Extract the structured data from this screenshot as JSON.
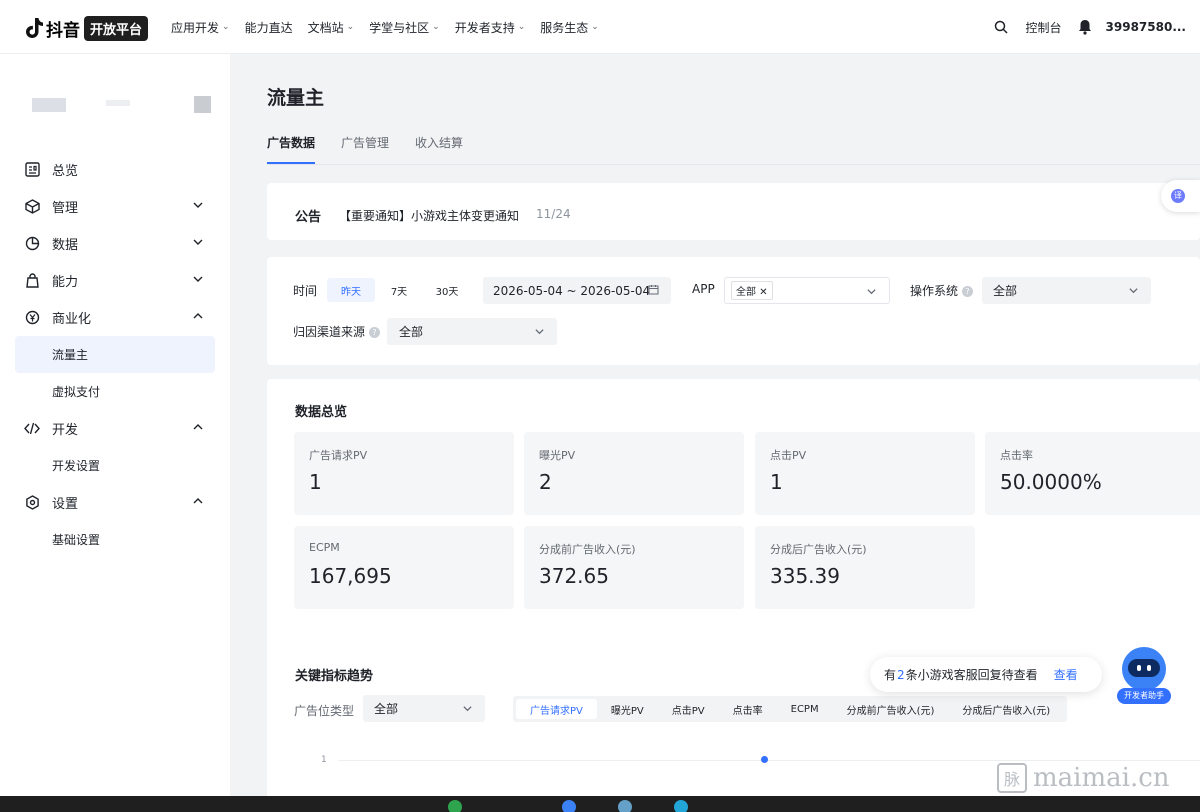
{
  "topbar": {
    "brand": "抖音",
    "badge": "开放平台",
    "nav": [
      {
        "label": "应用开发",
        "caret": true
      },
      {
        "label": "能力直达",
        "caret": false
      },
      {
        "label": "文档站",
        "caret": true
      },
      {
        "label": "学堂与社区",
        "caret": true
      },
      {
        "label": "开发者支持",
        "caret": true
      },
      {
        "label": "服务生态",
        "caret": true
      }
    ],
    "console": "控制台",
    "user_id": "39987580..."
  },
  "sidebar": {
    "items": [
      {
        "label": "总览",
        "icon": "dashboard-icon"
      },
      {
        "label": "管理",
        "icon": "cube-icon"
      },
      {
        "label": "数据",
        "icon": "pie-chart-icon"
      },
      {
        "label": "能力",
        "icon": "bag-icon"
      },
      {
        "label": "商业化",
        "icon": "yen-icon"
      },
      {
        "label": "开发",
        "icon": "code-icon"
      },
      {
        "label": "设置",
        "icon": "settings-icon"
      }
    ],
    "sub": {
      "traffic": "流量主",
      "virtual_pay": "虚拟支付",
      "dev_settings": "开发设置",
      "basic_settings": "基础设置"
    }
  },
  "page": {
    "title": "流量主",
    "tabs": [
      "广告数据",
      "广告管理",
      "收入结算"
    ]
  },
  "notice": {
    "label": "公告",
    "text": "【重要通知】小游戏主体变更通知",
    "date": "11/24"
  },
  "filters": {
    "time_label": "时间",
    "time_options": [
      "昨天",
      "7天",
      "30天"
    ],
    "date_range": "2026-05-04 ~ 2026-05-04",
    "app_label": "APP",
    "app_tag": "全部",
    "os_label": "操作系统",
    "os_value": "全部",
    "channel_label": "归因渠道来源",
    "channel_value": "全部"
  },
  "overview": {
    "title": "数据总览",
    "stats": [
      {
        "label": "广告请求PV",
        "value": "1"
      },
      {
        "label": "曝光PV",
        "value": "2"
      },
      {
        "label": "点击PV",
        "value": "1"
      },
      {
        "label": "点击率",
        "value": "50.0000%"
      },
      {
        "label": "ECPM",
        "value": "167,695"
      },
      {
        "label": "分成前广告收入(元)",
        "value": "372.65"
      },
      {
        "label": "分成后广告收入(元)",
        "value": "335.39"
      }
    ]
  },
  "trend": {
    "title": "关键指标趋势",
    "slot_label": "广告位类型",
    "slot_value": "全部",
    "metric_tabs": [
      "广告请求PV",
      "曝光PV",
      "点击PV",
      "点击率",
      "ECPM",
      "分成前广告收入(元)",
      "分成后广告收入(元)"
    ],
    "axis_tick": "1"
  },
  "chart_data": {
    "type": "line",
    "series": [
      {
        "values": [
          1
        ]
      }
    ],
    "y_ticks": [
      "1"
    ]
  },
  "toast": {
    "pre": "有",
    "count": "2",
    "post": "条小游戏客服回复待查看",
    "link": "查看"
  },
  "assistant": {
    "label": "开发者助手"
  },
  "translate": {
    "label": "译"
  },
  "watermark": {
    "icon": "脉",
    "text": "maimai.cn"
  },
  "colors": {
    "accent": "#3370ff",
    "active_bg": "#eef3fe",
    "page_bg": "#f2f3f5"
  }
}
